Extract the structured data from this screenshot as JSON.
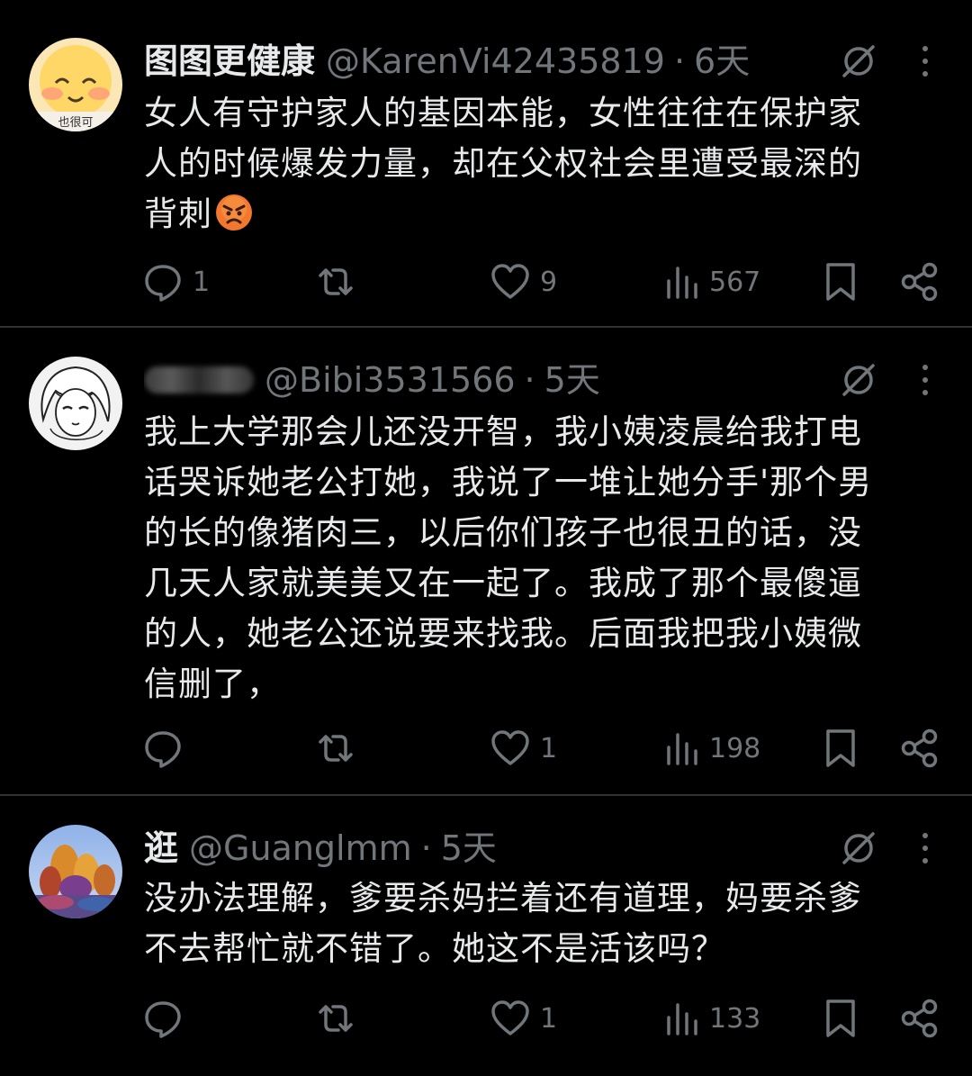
{
  "posts": [
    {
      "name": "图图更健康",
      "handle": "@KarenVi42435819",
      "separator": "·",
      "time": "6天",
      "avatar_text": "也很可",
      "text_lines": [
        "女人有守护家人的基因本能，女性往往在保护家",
        "人的时候爆发力量，却在父权社会里遭受最深的",
        "背刺"
      ],
      "emoji": "angry-face-emoji",
      "stats": {
        "replies": "1",
        "retweets": "",
        "likes": "9",
        "views": "567"
      }
    },
    {
      "name": "",
      "handle": "@Bibi3531566",
      "separator": "·",
      "time": "5天",
      "text_lines": [
        "我上大学那会儿还没开智，我小姨凌晨给我打电",
        "话哭诉她老公打她，我说了一堆让她分手'那个男",
        "的长的像猪肉三，以后你们孩子也很丑的话，没",
        "几天人家就美美又在一起了。我成了那个最傻逼",
        "的人，她老公还说要来找我。后面我把我小姨微",
        "信删了，"
      ],
      "stats": {
        "replies": "",
        "retweets": "",
        "likes": "1",
        "views": "198"
      }
    },
    {
      "name": "逛",
      "handle": "@Guanglmm",
      "separator": "·",
      "time": "5天",
      "text_lines": [
        "没办法理解，爹要杀妈拦着还有道理，妈要杀爹",
        "不去帮忙就不错了。她这不是活该吗？"
      ],
      "stats": {
        "replies": "",
        "retweets": "",
        "likes": "1",
        "views": "133"
      }
    }
  ],
  "icons": {
    "reply": "reply-icon",
    "retweet": "retweet-icon",
    "like": "like-heart-icon",
    "views": "views-chart-icon",
    "bookmark": "bookmark-icon",
    "share": "share-icon",
    "grok": "grok-icon",
    "more": "more-vertical-icon"
  },
  "colors": {
    "background": "#000000",
    "text": "#e7e9ea",
    "muted": "#71767b",
    "divider": "#2f3336"
  }
}
